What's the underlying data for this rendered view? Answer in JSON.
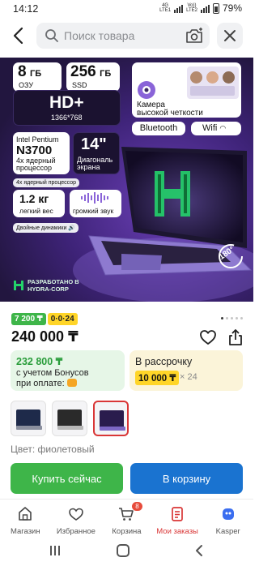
{
  "status_bar": {
    "time": "14:12",
    "network_top": "4G",
    "network_bottom": "LTE1",
    "volte_top": "Vo))",
    "volte_bottom": "LTE2",
    "battery": "79%"
  },
  "search": {
    "placeholder": "Поиск товара"
  },
  "product_image": {
    "spec_ram_value": "8",
    "spec_ram_unit": "ГБ",
    "spec_ram_label": "ОЗУ",
    "spec_ssd_value": "256",
    "spec_ssd_unit": "ГБ",
    "spec_ssd_label": "SSD",
    "camera_text_1": "Камера",
    "camera_text_2": "высокой четкости",
    "display_value": "HD+",
    "display_res": "1366*768",
    "bluetooth": "Bluetooth",
    "wifi": "Wifi",
    "cpu_brand": "Intel Pentium",
    "cpu_model": "N3700",
    "cpu_cores_1": "4х ядерный",
    "cpu_cores_2": "процессор",
    "screen_size": "14\"",
    "screen_label_1": "Диагональ",
    "screen_label_2": "экрана",
    "cpu_pill": "4х ядерный процессор",
    "weight_value": "1.2 кг",
    "weight_label": "легкий вес",
    "sound_label": "громкий звук",
    "speakers_pill": "Двойные динамики",
    "hinge_angle": "180°",
    "made_by_1": "РАЗРАБОТАНО В",
    "made_by_2": "HYDRA-CORP"
  },
  "badges": {
    "bonus": "7 200 ₸",
    "installment": "0·0·24"
  },
  "price": {
    "current": "240 000 ₸"
  },
  "bonus_card": {
    "amount": "232 800 ₸",
    "line1": "с учетом Бонусов",
    "line2": "при оплате:"
  },
  "credit_card": {
    "title": "В рассрочку",
    "value": "10 000 ₸",
    "multiplier": "× 24"
  },
  "color": {
    "label": "Цвет: фиолетовый"
  },
  "actions": {
    "buy_now": "Купить сейчас",
    "add_to_cart": "В корзину"
  },
  "bottom_nav": {
    "items": [
      {
        "label": "Магазин"
      },
      {
        "label": "Избранное"
      },
      {
        "label": "Корзина",
        "count": "8"
      },
      {
        "label": "Мои заказы"
      },
      {
        "label": "Kasper"
      }
    ]
  },
  "colors": {
    "green": "#3eb549",
    "blue": "#1a73d0",
    "yellow": "#ffd528",
    "active_red": "#d93636"
  }
}
